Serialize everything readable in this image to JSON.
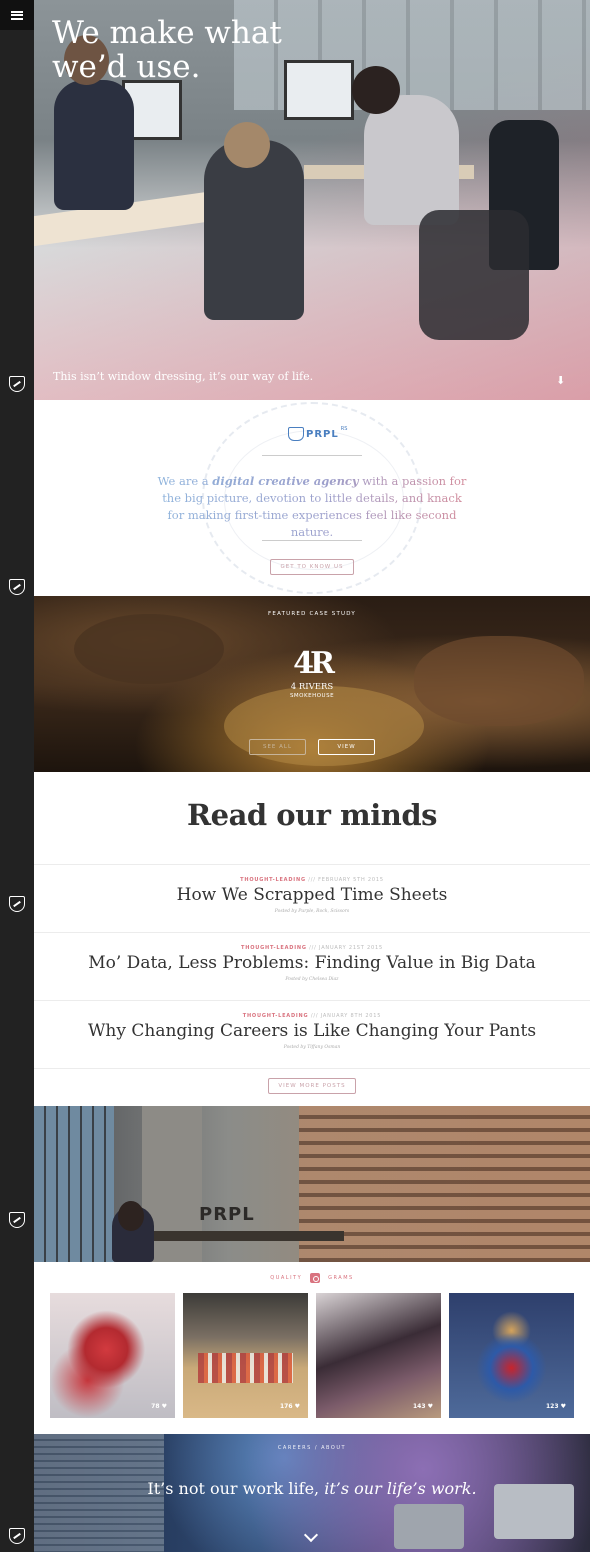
{
  "sidebar": {
    "menu_icon": "hamburger-icon",
    "logo_icon": "prpl-shield-icon"
  },
  "hero": {
    "headline": "We make what we’d use.",
    "tagline": "This isn’t window dressing, it’s our way of life.",
    "scroll_icon": "arrow-down-icon"
  },
  "agency": {
    "logo_text": "PRPL",
    "logo_sup": "RS",
    "intro_before": "We are a ",
    "intro_emphasis": "digital creative agency",
    "intro_after": " with a passion for the big picture, devotion to little details, and knack for making first-time experiences feel like second nature.",
    "button_label": "GET TO KNOW US"
  },
  "case_study": {
    "label": "FEATURED CASE STUDY",
    "logo_mark": "4R",
    "brand_name": "4 RIVERS",
    "brand_sub": "SMOKEHOUSE",
    "see_all_label": "SEE ALL",
    "view_label": "VIEW"
  },
  "blog": {
    "heading": "Read our minds",
    "posts": [
      {
        "category": "THOUGHT-LEADING",
        "date": "FEBRUARY 5TH 2015",
        "title": "How We Scrapped Time Sheets",
        "author": "Posted by Purple, Rock, Scissors"
      },
      {
        "category": "THOUGHT-LEADING",
        "date": "JANUARY 21ST 2015",
        "title": "Mo’ Data, Less Problems: Finding Value in Big Data",
        "author": "Posted by Chelsea Diaz"
      },
      {
        "category": "THOUGHT-LEADING",
        "date": "JANUARY 8TH 2015",
        "title": "Why Changing Careers is Like Changing Your Pants",
        "author": "Posted by Tiffany Osman"
      }
    ],
    "separator": "///",
    "more_label": "VIEW MORE POSTS"
  },
  "office": {
    "sign_text": "PRPL"
  },
  "grams": {
    "left_label": "QUALITY",
    "right_label": "GRAMS",
    "icon": "instagram-icon",
    "items": [
      {
        "likes": "78",
        "icon": "heart-icon"
      },
      {
        "likes": "176",
        "icon": "heart-icon"
      },
      {
        "likes": "143",
        "icon": "heart-icon"
      },
      {
        "likes": "123",
        "icon": "heart-icon"
      }
    ]
  },
  "life": {
    "label": "CAREERS / ABOUT",
    "headline_plain": "It’s not our work life, ",
    "headline_italic": "it’s our life’s work.",
    "scroll_icon": "chevron-down-icon"
  }
}
